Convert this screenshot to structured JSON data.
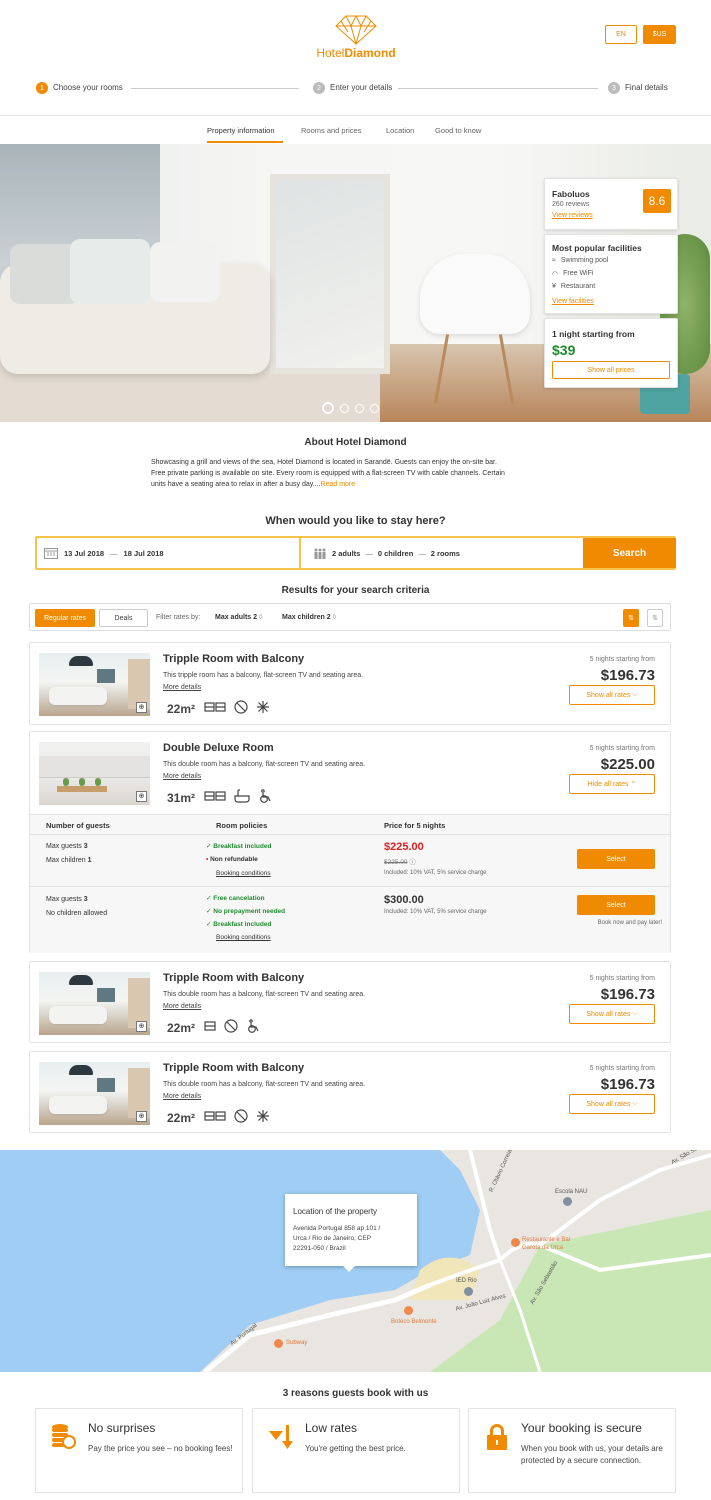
{
  "header": {
    "logo_text_light": "Hotel",
    "logo_text_bold": "Diamond",
    "lang_label": "EN",
    "currency_label": "$US"
  },
  "steps": [
    {
      "num": "1",
      "label": "Choose your rooms"
    },
    {
      "num": "2",
      "label": "Enter your details"
    },
    {
      "num": "3",
      "label": "Final details"
    }
  ],
  "tabs": [
    "Property information",
    "Rooms and prices",
    "Location",
    "Good to know"
  ],
  "hero": {
    "rating_label": "Faboluos",
    "reviews_count": "260 reviews",
    "view_reviews": "View reviews",
    "score": "8.6",
    "facilities_title": "Most popular facilities",
    "facilities": [
      "Swimming pool",
      "Free WiFi",
      "Restaurant"
    ],
    "view_facilities": "View facilities",
    "starting_label": "1 night starting from",
    "starting_price": "$39",
    "show_prices": "Show all prices"
  },
  "about": {
    "title": "About Hotel Diamond",
    "lines": [
      "Showcasing a grill and views of the sea, Hotel Diamond is located in Sarandë. Guests can enjoy the on-site bar.",
      "Free private parking is available on site. Every room is equipped with a flat-screen TV with cable channels. Certain",
      "units have a seating area to relax in after a busy day...."
    ],
    "read_more": "Read more"
  },
  "search": {
    "title": "When would you like to stay here?",
    "check_in": "13 Jul 2018",
    "dash": "—",
    "check_out": "18 Jul 2018",
    "adults": "2 adults",
    "children": "0 children",
    "rooms": "2 rooms",
    "button": "Search"
  },
  "results": {
    "title": "Results for your search criteria",
    "tab_regular": "Regular rates",
    "tab_deals": "Deals",
    "filter_label": "Filter rates by:",
    "filter_adults": "Max adults 2",
    "filter_children": "Max children 2"
  },
  "rooms": [
    {
      "title": "Tripple Room with Balcony",
      "desc": "This tripple room has a balcony, flat-screen TV and seating area.",
      "more": "More details",
      "size": "22m²",
      "from": "5 nights starting from",
      "price": "$196.73",
      "button": "Show all rates"
    },
    {
      "title": "Double Deluxe Room",
      "desc": "This double room has a balcony, flat-screen TV and seating area.",
      "more": "More details",
      "size": "31m²",
      "from": "5 nights starting from",
      "price": "$225.00",
      "button": "Hide all rates"
    },
    {
      "title": "Tripple Room with Balcony",
      "desc": "This double room has a balcony, flat-screen TV and seating area.",
      "more": "More details",
      "size": "22m²",
      "from": "5 nights starting from",
      "price": "$196.73",
      "button": "Show all rates"
    },
    {
      "title": "Tripple Room with Balcony",
      "desc": "This double room has a balcony, flat-screen TV and seating area.",
      "more": "More details",
      "size": "22m²",
      "from": "5 nights starting from",
      "price": "$196.73",
      "button": "Show all rates"
    }
  ],
  "rates_table": {
    "headers": [
      "Number of guests",
      "Room policies",
      "Price for 5 nights"
    ],
    "rows": [
      {
        "guests_label": "Max guests ",
        "guests_num": "3",
        "children_label": "Max children ",
        "children_num": "1",
        "policies": [
          "Breakfast included",
          "Non refundable"
        ],
        "conditions": "Booking conditions",
        "price": "$225.00",
        "old_price": "$225.00",
        "tax": "Included: 10% VAT,  5% service charge",
        "button": "Select",
        "note": ""
      },
      {
        "guests_label": "Max guests ",
        "guests_num": "3",
        "children_label": "No children allowed",
        "children_num": "",
        "policies": [
          "Free cancelation",
          "No prepayment needed",
          "Breakfast included"
        ],
        "conditions": "Booking conditions",
        "price": "$300.00",
        "old_price": "",
        "tax": "Included: 10% VAT,  5% service charge",
        "button": "Select",
        "note": "Book now and pay later!"
      }
    ]
  },
  "map": {
    "popup_title": "Location of the property",
    "popup_address": [
      "Avenida Portugal 858 ap 101 /",
      "Urca / Rio de Janeiro, CEP",
      "22291-050 / Brazil"
    ],
    "labels": [
      "Escola NAU",
      "Restaurante e Bar",
      "Garota da Urca",
      "IED Rio",
      "Boteco Belmonte",
      "Subway",
      "Av. Portugal",
      "Av. João Luiz Alves",
      "Av. São Sebastião",
      "R. Otávio Correia",
      "Av. São Se"
    ]
  },
  "reasons": {
    "title": "3 reasons guests book with us",
    "items": [
      {
        "title": "No surprises",
        "text": "Pay the price you see – no booking fees!"
      },
      {
        "title": "Low rates",
        "text": "You're getting the best price."
      },
      {
        "title": "Your booking is secure",
        "text": "When you book with us, your details are protected by a secure connection."
      }
    ]
  },
  "colors": {
    "accent": "#f08a00",
    "green": "#1e8a2e",
    "red": "#e02020"
  }
}
